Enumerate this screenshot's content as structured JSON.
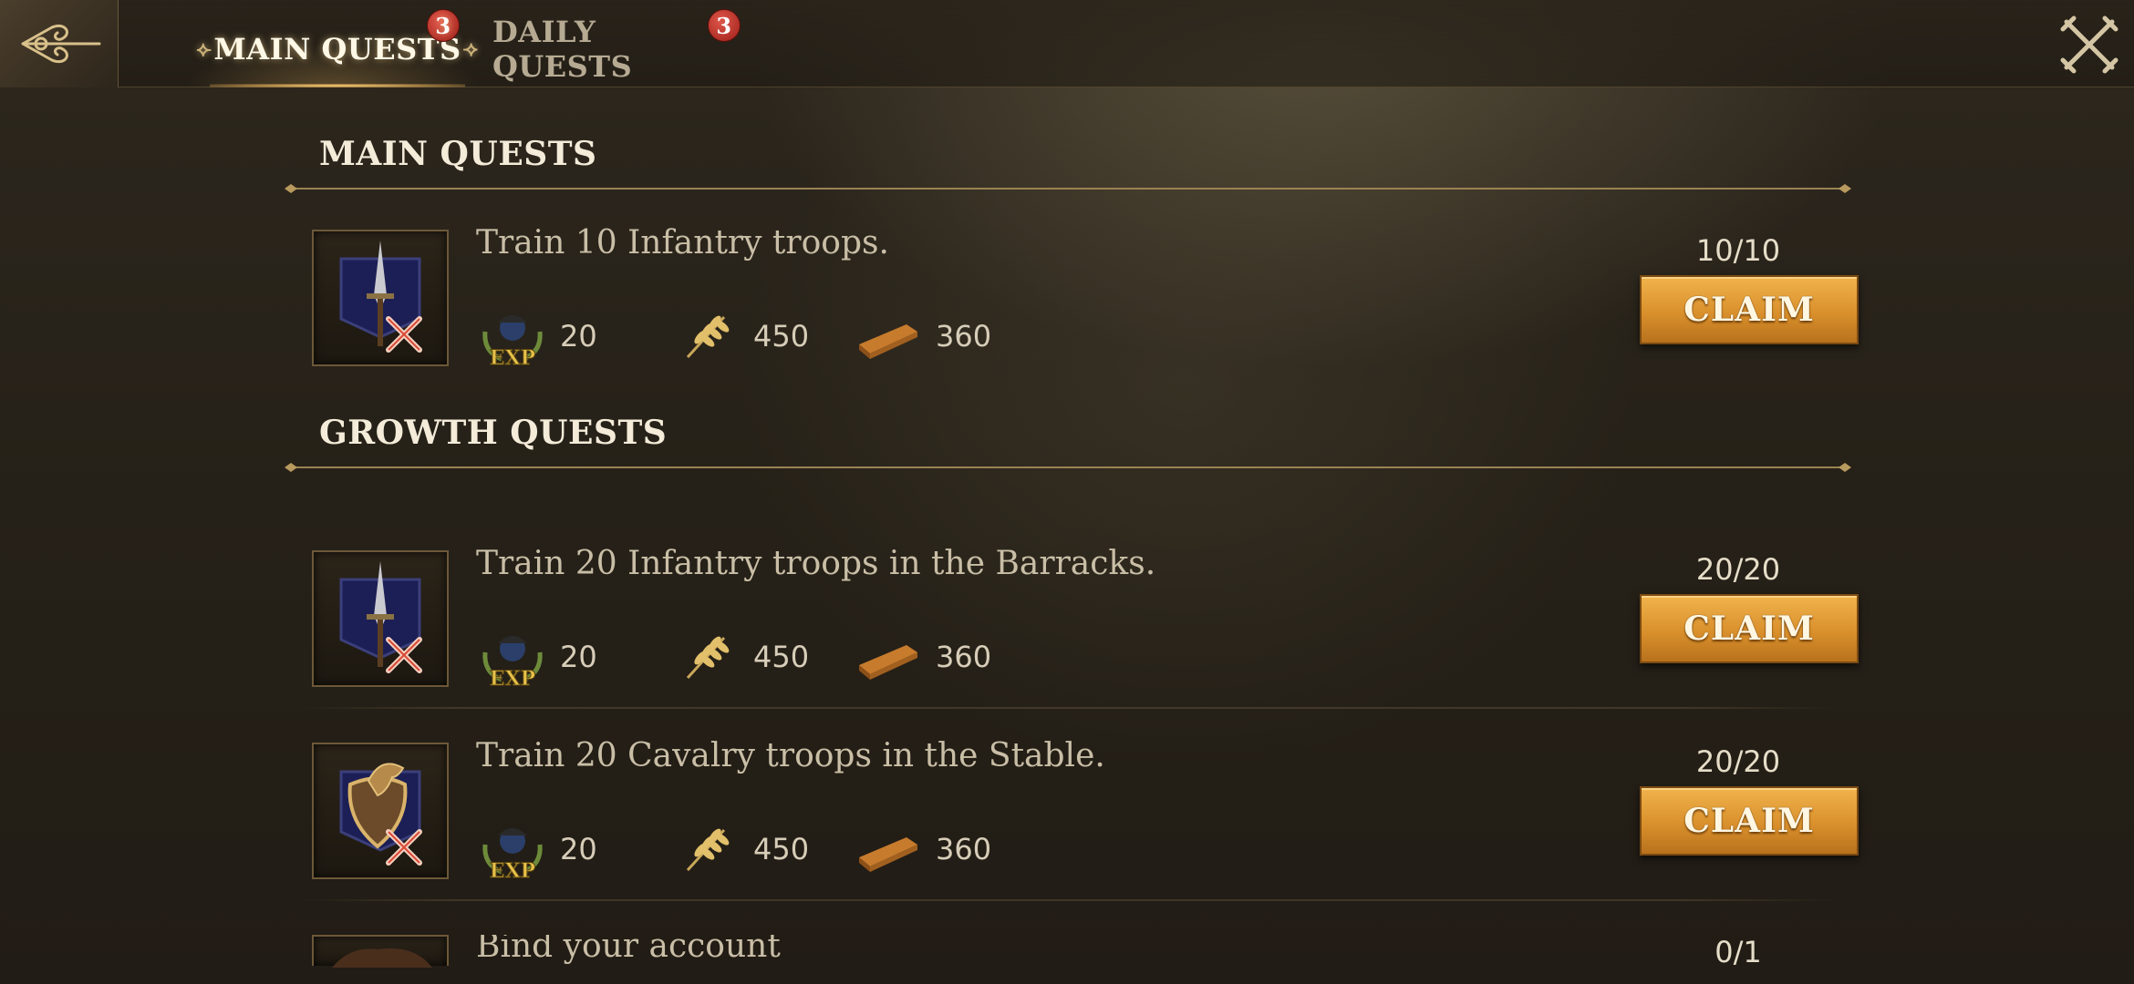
{
  "tabs": [
    {
      "label": "MAIN QUESTS",
      "badge": "3"
    },
    {
      "label": "DAILY QUESTS",
      "badge": "3"
    }
  ],
  "sections": {
    "main": {
      "title": "MAIN QUESTS"
    },
    "growth": {
      "title": "GROWTH QUESTS"
    }
  },
  "quests": [
    {
      "title": "Train 10 Infantry troops.",
      "icon": "infantry-quest-icon",
      "progress": "10/10",
      "claim": "CLAIM",
      "rewards": [
        {
          "icon": "exp-icon",
          "label": "EXP",
          "value": "20"
        },
        {
          "icon": "wheat-icon",
          "value": "450"
        },
        {
          "icon": "wood-icon",
          "value": "360"
        }
      ]
    },
    {
      "title": "Train 20 Infantry troops in the Barracks.",
      "icon": "infantry-quest-icon",
      "progress": "20/20",
      "claim": "CLAIM",
      "rewards": [
        {
          "icon": "exp-icon",
          "label": "EXP",
          "value": "20"
        },
        {
          "icon": "wheat-icon",
          "value": "450"
        },
        {
          "icon": "wood-icon",
          "value": "360"
        }
      ]
    },
    {
      "title": "Train 20 Cavalry troops in the Stable.",
      "icon": "cavalry-quest-icon",
      "progress": "20/20",
      "claim": "CLAIM",
      "rewards": [
        {
          "icon": "exp-icon",
          "label": "EXP",
          "value": "20"
        },
        {
          "icon": "wheat-icon",
          "value": "450"
        },
        {
          "icon": "wood-icon",
          "value": "360"
        }
      ]
    },
    {
      "title": "Bind your account",
      "icon": "account-quest-icon",
      "progress": "0/1"
    }
  ],
  "colors": {
    "accent_gold": "#d9902c",
    "badge_red": "#b3261e",
    "text_light": "#f4ecd9"
  }
}
